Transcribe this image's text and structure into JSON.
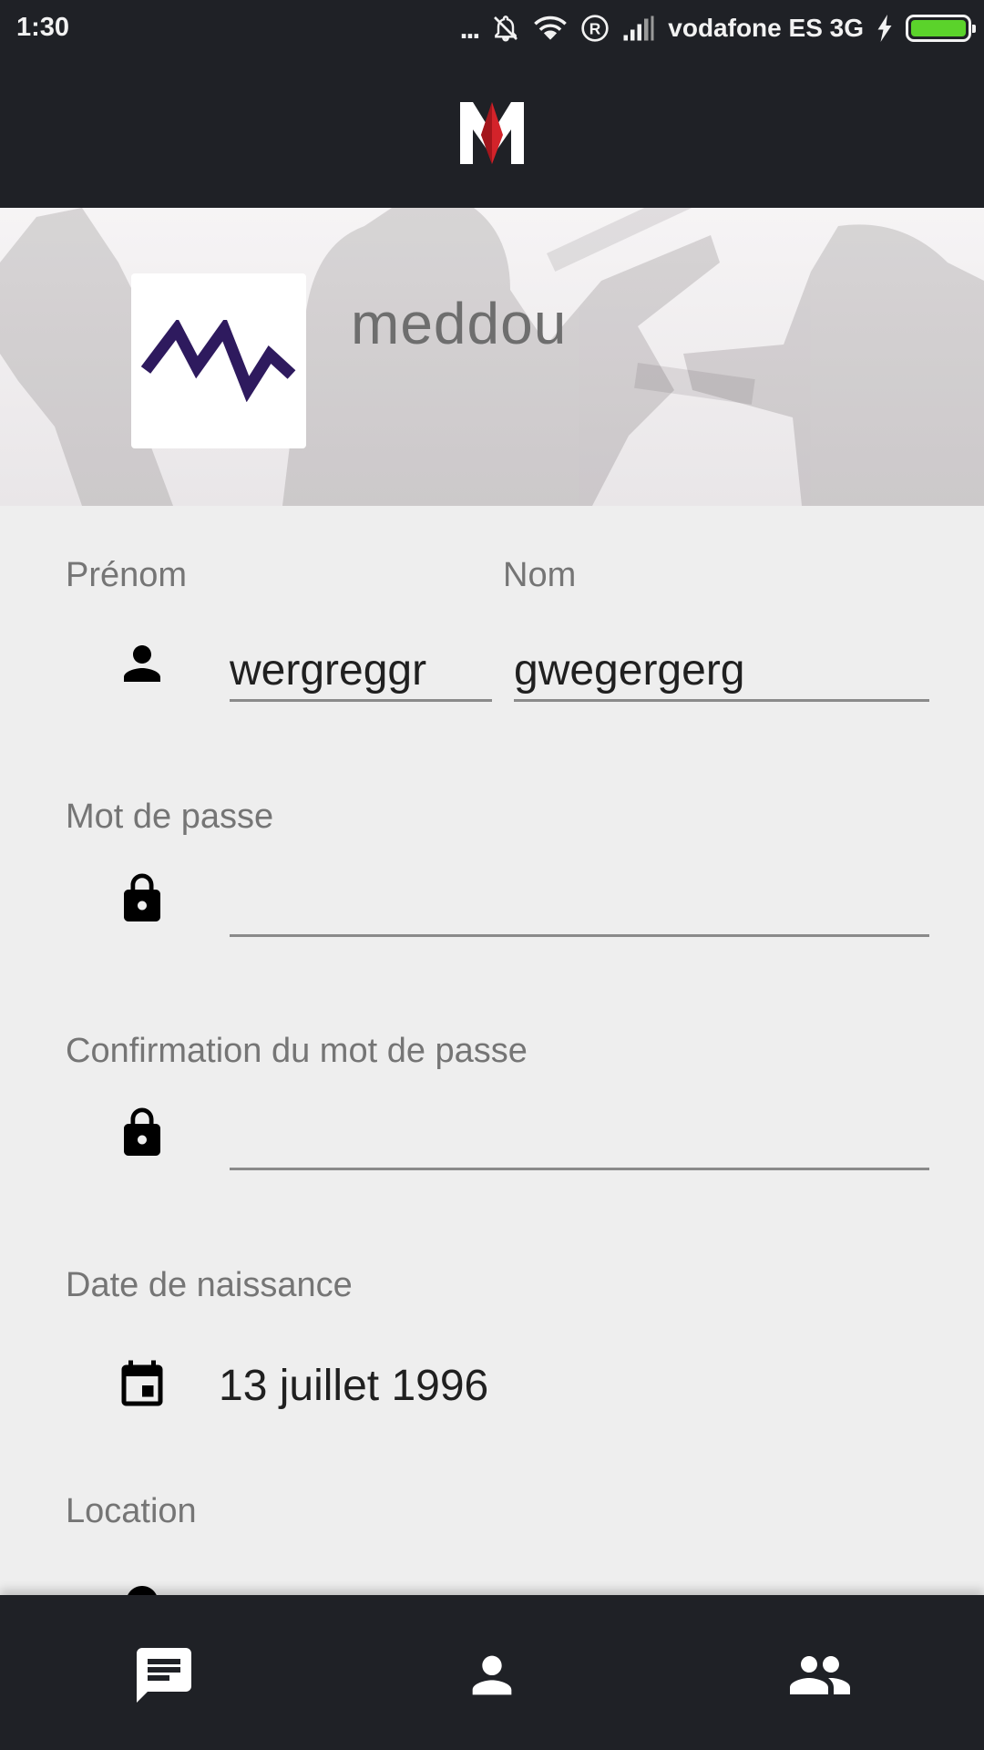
{
  "status_bar": {
    "time": "1:30",
    "dots": "...",
    "carrier": "vodafone ES 3G",
    "battery_level": 1.0,
    "icons": [
      "more-dots-icon",
      "bell-off-icon",
      "wifi-icon",
      "roaming-icon",
      "signal-icon",
      "charging-bolt-icon",
      "battery-icon"
    ]
  },
  "app_bar": {
    "logo": "app-logo-m"
  },
  "profile": {
    "username": "meddou",
    "avatar": "mw-logo"
  },
  "form": {
    "first_name": {
      "label": "Prénom",
      "value": "wergreggr",
      "icon": "person-icon"
    },
    "last_name": {
      "label": "Nom",
      "value": "gwegergerg"
    },
    "password": {
      "label": "Mot de passe",
      "value": "",
      "icon": "lock-icon"
    },
    "password_confirm": {
      "label": "Confirmation du mot de passe",
      "value": "",
      "icon": "lock-icon"
    },
    "birth_date": {
      "label": "Date de naissance",
      "value": "13 juillet 1996",
      "icon": "calendar-icon"
    },
    "location": {
      "label": "Location",
      "icon": "location-pin-icon"
    }
  },
  "bottom_nav": {
    "items": [
      {
        "name": "messages",
        "icon": "chat-icon"
      },
      {
        "name": "profile",
        "icon": "person-icon"
      },
      {
        "name": "friends",
        "icon": "group-icon"
      }
    ]
  },
  "colors": {
    "bars": "#1f2126",
    "background": "#eeeeee",
    "label": "#757575",
    "logo_red": "#d3232a",
    "avatar_purple": "#2e1a5e",
    "battery": "#5bd32b"
  }
}
